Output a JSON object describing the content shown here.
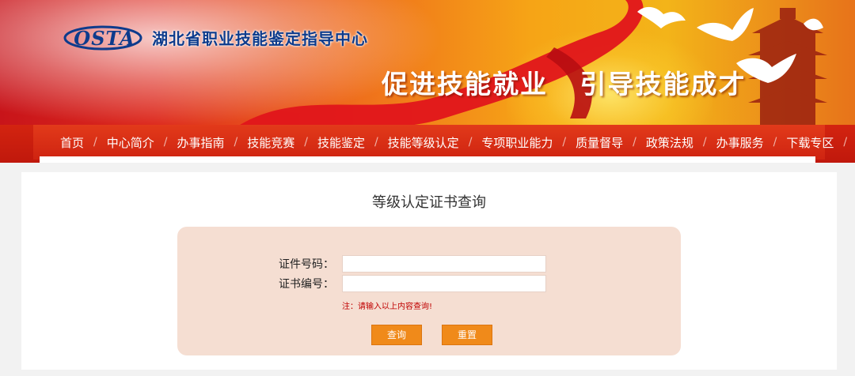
{
  "header": {
    "logo_text": "OSTA",
    "org_name": "湖北省职业技能鉴定指导中心",
    "slogan": "促进技能就业   引导技能成才"
  },
  "nav": {
    "items": [
      {
        "label": "首页"
      },
      {
        "label": "中心简介"
      },
      {
        "label": "办事指南"
      },
      {
        "label": "技能竞赛"
      },
      {
        "label": "技能鉴定"
      },
      {
        "label": "技能等级认定"
      },
      {
        "label": "专项职业能力"
      },
      {
        "label": "质量督导"
      },
      {
        "label": "政策法规"
      },
      {
        "label": "办事服务"
      },
      {
        "label": "下载专区"
      }
    ],
    "separator": "/"
  },
  "main": {
    "title": "等级认定证书查询",
    "form": {
      "id_label": "证件号码：",
      "id_value": "",
      "cert_label": "证书编号：",
      "cert_value": "",
      "note": "注：请输入以上内容查询!",
      "query_button": "查询",
      "reset_button": "重置"
    }
  },
  "colors": {
    "nav_red": "#cf2411",
    "button_orange": "#f08a1a",
    "panel_bg": "#f5ded2",
    "logo_blue": "#0d3b8c"
  }
}
